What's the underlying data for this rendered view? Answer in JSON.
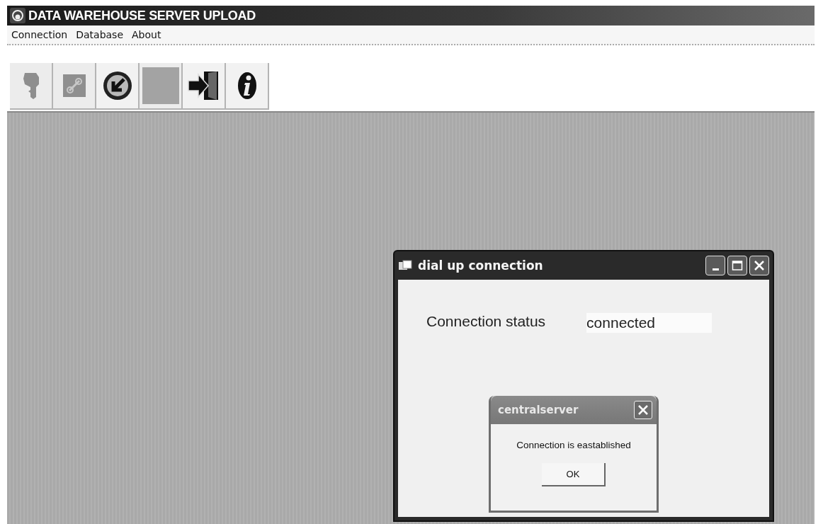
{
  "window": {
    "title": "DATA WAREHOUSE SERVER UPLOAD"
  },
  "menu": [
    {
      "label": "Connection"
    },
    {
      "label": "Database"
    },
    {
      "label": "About"
    }
  ],
  "toolbar": [
    {
      "kind": "key",
      "disabled": true
    },
    {
      "kind": "chain",
      "disabled": true
    },
    {
      "kind": "dial",
      "disabled": false
    },
    {
      "kind": "blank",
      "disabled": true
    },
    {
      "kind": "exit",
      "disabled": false
    },
    {
      "kind": "info",
      "disabled": false
    }
  ],
  "dialog": {
    "title": "dial up connection",
    "label": "Connection status",
    "value": "connected"
  },
  "message_box": {
    "title": "centralserver",
    "message": "Connection is eastablished",
    "button": "OK"
  }
}
